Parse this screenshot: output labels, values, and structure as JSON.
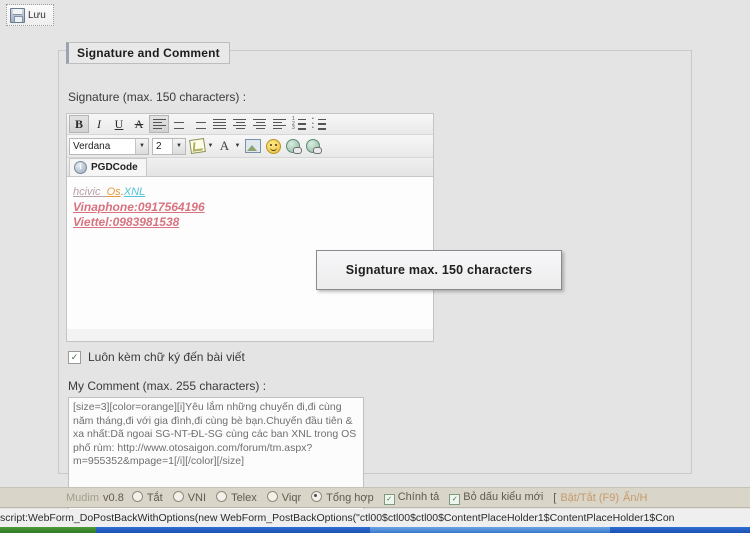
{
  "toolbar_top": {
    "save_label": "Lưu",
    "save_icon": "floppy-disk-icon"
  },
  "panel": {
    "legend": "Signature and Comment"
  },
  "signature": {
    "label": "Signature (max. 150 characters) :",
    "editor_toolbar": {
      "row1": [
        {
          "name": "bold",
          "glyph": "B",
          "pressed": true
        },
        {
          "name": "italic",
          "glyph": "I",
          "pressed": false
        },
        {
          "name": "underline",
          "glyph": "U",
          "pressed": false
        },
        {
          "name": "strikethrough",
          "glyph": "A",
          "pressed": false
        },
        {
          "name": "align-left",
          "glyph": "",
          "pressed": true
        },
        {
          "name": "align-center",
          "glyph": "",
          "pressed": false
        },
        {
          "name": "align-right",
          "glyph": "",
          "pressed": false
        },
        {
          "name": "align-justify",
          "glyph": "",
          "pressed": false
        },
        {
          "name": "align-distribute",
          "glyph": "",
          "pressed": false
        },
        {
          "name": "indent-increase",
          "glyph": "",
          "pressed": false
        },
        {
          "name": "indent-decrease",
          "glyph": "",
          "pressed": false
        },
        {
          "name": "ordered-list",
          "glyph": "",
          "pressed": false
        },
        {
          "name": "unordered-list",
          "glyph": "",
          "pressed": false
        }
      ],
      "font_family": "Verdana",
      "font_size": "2",
      "row2_icons": [
        "highlight-color-icon",
        "font-color-icon",
        "insert-image-icon",
        "emoticon-icon",
        "insert-link-icon",
        "remove-link-icon"
      ]
    },
    "tab_label": "PGDCode",
    "tab_icon": "info-icon",
    "content": {
      "line1_part1": "hcivic_",
      "line1_part2": "Os",
      "line1_part3": ".",
      "line1_part4": "XNL",
      "line2": "Vinaphone:0917564196",
      "line3": "Viettel:0983981538"
    }
  },
  "tooltip": {
    "text": "Signature max. 150 characters"
  },
  "attach_signature": {
    "label": "Luôn kèm chữ ký đến bài viết",
    "checked": true,
    "check_glyph": "✓"
  },
  "comment": {
    "label": "My Comment (max. 255 characters) :",
    "value": "[size=3][color=orange][i]Yêu lắm những chuyến đi,đi cùng năm tháng,đi với gia đình,đi cùng bè bạn.Chuyến đầu tiên & xa nhất:Dã ngoai SG-NT-ĐL-SG cùng các ban XNL trong OS phố rùm: http://www.otosaigon.com/forum/tm.aspx?m=955352&mpage=1[/i][/color][/size]"
  },
  "mudim": {
    "brand": "Mudim",
    "version": "v0.8",
    "modes": [
      {
        "label": "Tắt",
        "selected": false
      },
      {
        "label": "VNI",
        "selected": false
      },
      {
        "label": "Telex",
        "selected": false
      },
      {
        "label": "Viqr",
        "selected": false
      },
      {
        "label": "Tổng hợp",
        "selected": true
      }
    ],
    "options": [
      {
        "label": "Chính tả",
        "checked": true
      },
      {
        "label": "Bỏ dấu kiểu mới",
        "checked": true
      }
    ],
    "hotkey_open": "[",
    "hotkey_toggle": "Bật/Tắt (F9)",
    "hotkey_hide": "Ẩn/H"
  },
  "statusbar": {
    "text": "script:WebForm_DoPostBackWithOptions(new WebForm_PostBackOptions(\"ctl00$ctl00$ctl00$ContentPlaceHolder1$ContentPlaceHolder1$Con"
  },
  "colors": {
    "page_bg": "#e4e4e4",
    "mudim_bg": "#d9d5c8",
    "accent_pink": "#d8737f",
    "accent_orange": "#e39a3c",
    "accent_cyan": "#4fc3d6"
  }
}
